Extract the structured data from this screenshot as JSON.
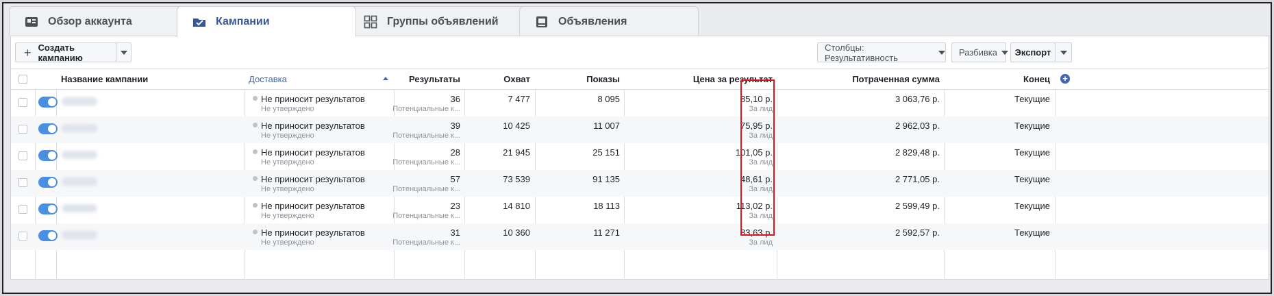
{
  "tabs": [
    {
      "label": "Обзор аккаунта",
      "icon": "account-overview-icon"
    },
    {
      "label": "Кампании",
      "icon": "campaigns-check-icon",
      "active": true
    },
    {
      "label": "Группы объявлений",
      "icon": "ad-sets-grid-icon"
    },
    {
      "label": "Объявления",
      "icon": "ads-icon"
    }
  ],
  "toolbar": {
    "create_label": "Создать кампанию",
    "columns_label": "Столбцы: Результативность",
    "breakdown_label": "Разбивка",
    "export_label": "Экспорт"
  },
  "table": {
    "headers": {
      "name": "Название кампании",
      "delivery": "Доставка",
      "results": "Результаты",
      "reach": "Охват",
      "impressions": "Показы",
      "cost": "Цена за результат",
      "spent": "Потраченная сумма",
      "end": "Конец"
    },
    "rows": [
      {
        "delivery": "Не приносит результатов",
        "delivery_sub": "Не утверждено",
        "results": "36",
        "results_sub": "Потенциальные к...",
        "reach": "7 477",
        "impressions": "8 095",
        "cost": "85,10 р.",
        "cost_sub": "За лид",
        "spent": "3 063,76 р.",
        "end": "Текущие"
      },
      {
        "delivery": "Не приносит результатов",
        "delivery_sub": "Не утверждено",
        "results": "39",
        "results_sub": "Потенциальные к...",
        "reach": "10 425",
        "impressions": "11 007",
        "cost": "75,95 р.",
        "cost_sub": "За лид",
        "spent": "2 962,03 р.",
        "end": "Текущие"
      },
      {
        "delivery": "Не приносит результатов",
        "delivery_sub": "Не утверждено",
        "results": "28",
        "results_sub": "Потенциальные к...",
        "reach": "21 945",
        "impressions": "25 151",
        "cost": "101,05 р.",
        "cost_sub": "За лид",
        "spent": "2 829,48 р.",
        "end": "Текущие"
      },
      {
        "delivery": "Не приносит результатов",
        "delivery_sub": "Не утверждено",
        "results": "57",
        "results_sub": "Потенциальные к...",
        "reach": "73 539",
        "impressions": "91 135",
        "cost": "48,61 р.",
        "cost_sub": "За лид",
        "spent": "2 771,05 р.",
        "end": "Текущие"
      },
      {
        "delivery": "Не приносит результатов",
        "delivery_sub": "Не утверждено",
        "results": "23",
        "results_sub": "Потенциальные к...",
        "reach": "14 810",
        "impressions": "18 113",
        "cost": "113,02 р.",
        "cost_sub": "За лид",
        "spent": "2 599,49 р.",
        "end": "Текущие"
      },
      {
        "delivery": "Не приносит результатов",
        "delivery_sub": "Не утверждено",
        "results": "31",
        "results_sub": "Потенциальные к...",
        "reach": "10 360",
        "impressions": "11 271",
        "cost": "83,63 р.",
        "cost_sub": "За лид",
        "spent": "2 592,57 р.",
        "end": "Текущие"
      }
    ]
  },
  "colors": {
    "link": "#4267b2",
    "toggle": "#4a90e2",
    "highlight": "#e3121d"
  }
}
